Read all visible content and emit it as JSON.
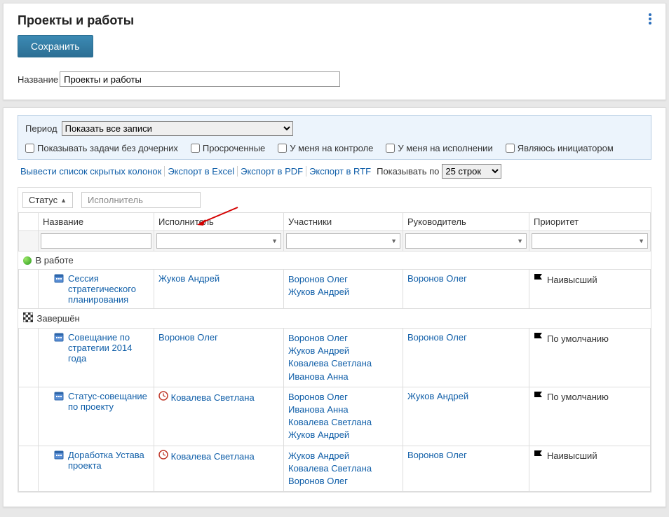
{
  "header": {
    "title": "Проекты и работы",
    "save_label": "Сохранить",
    "name_label": "Название",
    "name_value": "Проекты и работы"
  },
  "filters": {
    "period_label": "Период",
    "period_value": "Показать все записи",
    "chk_no_children": "Показывать задачи без дочерних",
    "chk_overdue": "Просроченные",
    "chk_my_control": "У меня на контроле",
    "chk_my_exec": "У меня на исполнении",
    "chk_initiator": "Являюсь инициатором"
  },
  "toolbar": {
    "hidden_cols": "Вывести список скрытых колонок",
    "export_excel": "Экспорт в Excel",
    "export_pdf": "Экспорт в PDF",
    "export_rtf": "Экспорт в RTF",
    "show_by_label": "Показывать по",
    "page_size": "25 строк"
  },
  "group_chips": {
    "status": "Статус",
    "executor_placeholder": "Исполнитель"
  },
  "columns": {
    "name": "Название",
    "executor": "Исполнитель",
    "participants": "Участники",
    "leader": "Руководитель",
    "priority": "Приоритет"
  },
  "groups": [
    {
      "status": "В работе",
      "status_kind": "green",
      "rows": [
        {
          "name": "Сессия стратегического планирования",
          "executor": "Жуков Андрей",
          "executor_icon": "none",
          "participants": [
            "Воронов Олег",
            "Жуков Андрей"
          ],
          "leader": "Воронов Олег",
          "priority": "Наивысший",
          "priority_color": "red"
        }
      ]
    },
    {
      "status": "Завершён",
      "status_kind": "finish",
      "rows": [
        {
          "name": "Совещание по стратегии 2014 года",
          "executor": "Воронов Олег",
          "executor_icon": "none",
          "participants": [
            "Воронов Олег",
            "Жуков Андрей",
            "Ковалева Светлана",
            "Иванова Анна"
          ],
          "leader": "Воронов Олег",
          "priority": "По умолчанию",
          "priority_color": "grey"
        },
        {
          "name": "Статус-совещание по проекту",
          "executor": "Ковалева Светлана",
          "executor_icon": "clock",
          "participants": [
            "Воронов Олег",
            "Иванова Анна",
            "Ковалева Светлана",
            "Жуков Андрей"
          ],
          "leader": "Жуков Андрей",
          "priority": "По умолчанию",
          "priority_color": "grey"
        },
        {
          "name": "Доработка Устава проекта",
          "executor": "Ковалева Светлана",
          "executor_icon": "clock",
          "participants": [
            "Жуков Андрей",
            "Ковалева Светлана",
            "Воронов Олег"
          ],
          "leader": "Воронов Олег",
          "priority": "Наивысший",
          "priority_color": "red"
        }
      ]
    }
  ]
}
